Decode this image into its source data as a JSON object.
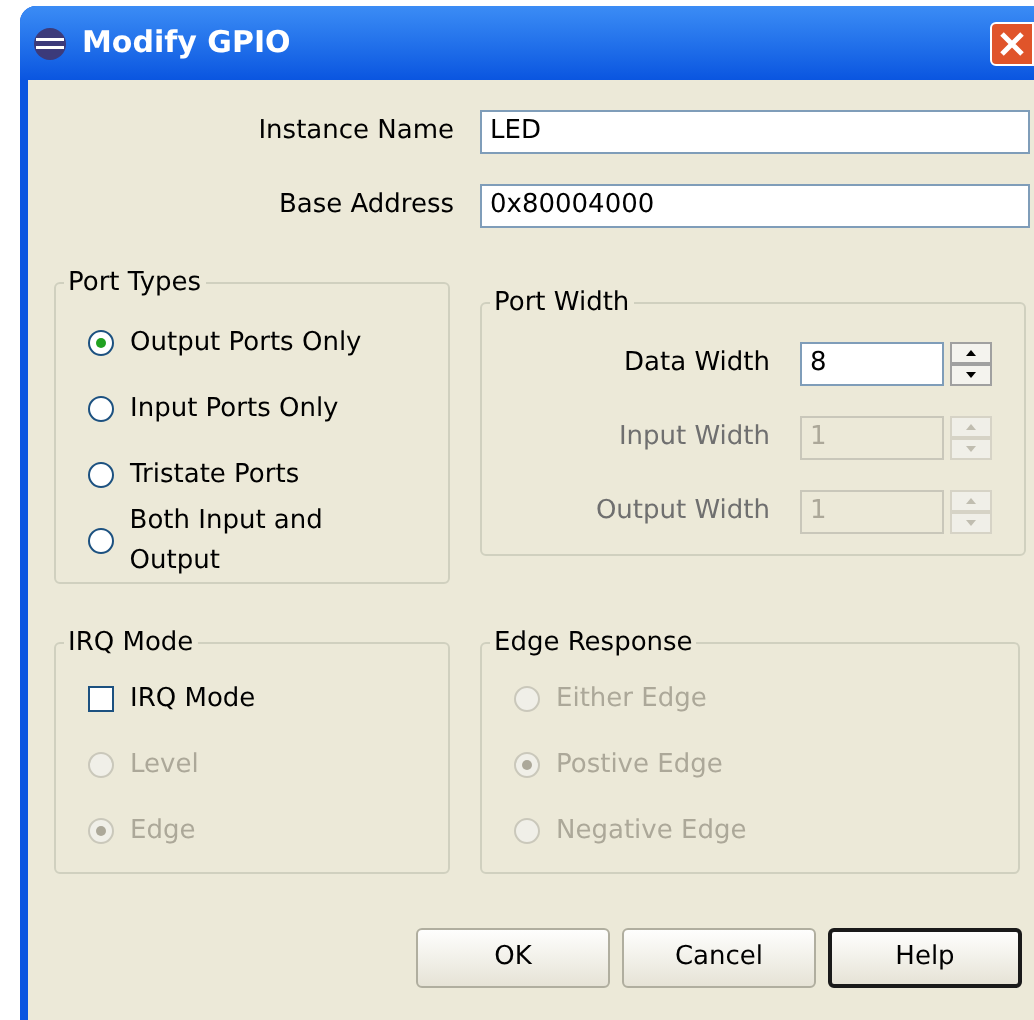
{
  "window": {
    "title": "Modify GPIO"
  },
  "fields": [
    {
      "label": "Instance Name",
      "value": "LED"
    },
    {
      "label": "Base Address",
      "value": "0x80004000"
    }
  ],
  "port_types": {
    "title": "Port Types",
    "options": [
      {
        "label": "Output Ports Only",
        "selected": true
      },
      {
        "label": "Input Ports Only",
        "selected": false
      },
      {
        "label": "Tristate Ports",
        "selected": false
      },
      {
        "label": "Both Input and Output",
        "selected": false
      }
    ]
  },
  "port_width": {
    "title": "Port Width",
    "rows": [
      {
        "label": "Data Width",
        "value": "8",
        "disabled": false
      },
      {
        "label": "Input Width",
        "value": "1",
        "disabled": true
      },
      {
        "label": "Output Width",
        "value": "1",
        "disabled": true
      }
    ]
  },
  "irq_mode": {
    "title": "IRQ Mode",
    "checkbox": {
      "label": "IRQ Mode",
      "checked": false
    },
    "options": [
      {
        "label": "Level",
        "selected": false,
        "disabled": true
      },
      {
        "label": "Edge",
        "selected": true,
        "disabled": true
      }
    ]
  },
  "edge_response": {
    "title": "Edge Response",
    "options": [
      {
        "label": "Either Edge",
        "selected": false,
        "disabled": true
      },
      {
        "label": "Postive Edge",
        "selected": true,
        "disabled": true
      },
      {
        "label": "Negative Edge",
        "selected": false,
        "disabled": true
      }
    ]
  },
  "buttons": [
    {
      "label": "OK",
      "default": false
    },
    {
      "label": "Cancel",
      "default": false
    },
    {
      "label": "Help",
      "default": true
    }
  ]
}
